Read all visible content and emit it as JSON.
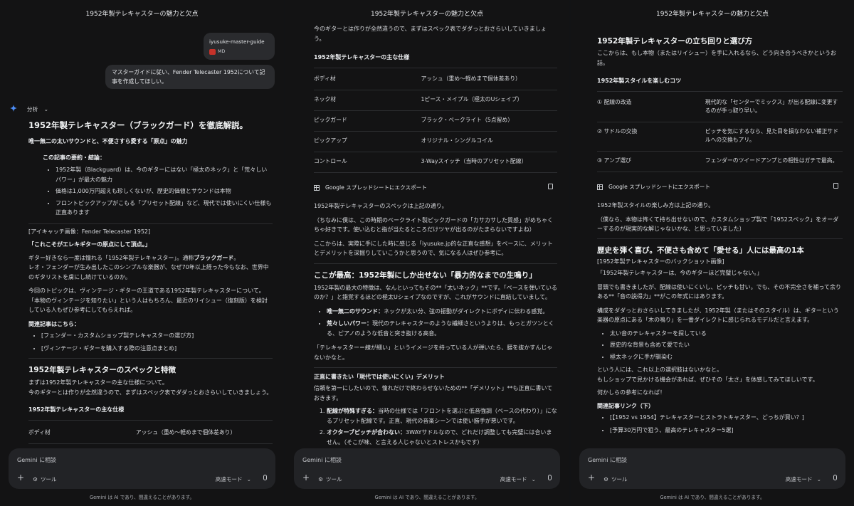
{
  "title": "1952年製テレキャスターの魅力と欠点",
  "colors": {
    "bg": "#131314",
    "bubble": "#2a2b2e",
    "input": "#222326",
    "accent_star": "#4c8df6"
  },
  "user": {
    "gem_name": "iyusuke-master-guide",
    "gem_tag": "MD",
    "message": "マスターガイドに従い、Fender Telecaster 1952について記事を作成してほしい。"
  },
  "analysis_label": "分析",
  "panel1": {
    "h1": "1952年製テレキャスター（ブラックガード）を徹底解説。",
    "subtitle": "唯一無二の太いサウンドと、不便さすら愛する「原点」の魅力",
    "summary_title": "この記事の要約・結論：",
    "summary_items": [
      "1952年製（Blackguard）は、今のギターにはない「極太のネック」と「荒々しいパワー」が最大の魅力",
      "価格は1,000万円超えも珍しくないが、歴史的価値とサウンドは本物",
      "フロントピックアップがこもる「プリセット配線」など、現代では使いにくい仕様も正直あります"
    ],
    "eyecatch": "[アイキャッチ画像：Fender Telecaster 1952]",
    "catch": "「これこそがエレキギターの原点にして頂点。」",
    "intro1a": "ギター好きなら一度は憧れる「1952年製テレキャスター」。通称",
    "intro1b": "ブラックガード",
    "intro1c": "。",
    "intro2": "レオ・フェンダーが生み出したこのシンプルな楽器が、なぜ70年以上経った今もなお、世界中のギタリストを虜にし続けているのか。",
    "intro3": "今回のトピックは、ヴィンテージ・ギターの王道である1952年製テレキャスターについて。「本物のヴィンテージを知りたい」という人はもちろん、最近のリイシュー（復刻版）を検討している人もぜひ参考にしてもらえれば。",
    "related_title": "関連記事はこちら：",
    "related": [
      "[フェンダー・カスタムショップ製テレキャスターの選び方]",
      "[ヴィンテージ・ギターを購入する際の注意点まとめ]"
    ],
    "spec_h": "1952年製テレキャスターのスペックと特徴",
    "spec_p1": "まずは1952年製テレキャスターの主な仕様について。",
    "spec_p2": "今のギターとは作りが全然違うので、まずはスペック表でダダっとおさらいしていきましょう。",
    "table_title": "1952年製テレキャスターの主な仕様",
    "partial_row": [
      "ボディ材",
      "アッシュ（重め〜軽めまで個体差あり）"
    ]
  },
  "panel2": {
    "top": "今のギターとは作りが全然違うので、まずはスペック表でダダっとおさらいしていきましょう。",
    "table_title": "1952年製テレキャスターの主な仕様",
    "rows": [
      [
        "ボディ材",
        "アッシュ（重め〜軽めまで個体差あり）"
      ],
      [
        "ネック材",
        "1ピース・メイプル（極太のUシェイプ）"
      ],
      [
        "ピックガード",
        "ブラック・ベークライト（5点留め）"
      ],
      [
        "ピックアップ",
        "オリジナル・シングルコイル"
      ],
      [
        "コントロール",
        "3-Wayスイッチ（当時のプリセット配線）"
      ]
    ],
    "export": "Google スプレッドシートにエクスポート",
    "after": "1952年製テレキャスターのスペックは上記の通り。",
    "aside": "（ちなみに僕は、この時期のベークライト製ピックガードの「カサカサした質感」がめちゃくちゃ好きです。使い込むと指が当たるところだけツヤが出るのがたまらないですよね）",
    "lead": "ここからは、実際に手にした時に感じる「iyusuke.jp的な正直な感想」をベースに、メリットとデメリットを深掘りしていこうかと思うので、気になる人はぜひ参考に。",
    "h_best": "ここが最高：1952年製にしか出せない「暴力的なまでの生鳴り」",
    "best_p": "1952年製の最大の特徴は、なんといってもその**「太いネック」**です。「ベースを弾いているのか？」と錯覚するほどの極太Uシェイプなのですが、これがサウンドに直結していまして。",
    "best_items": [
      {
        "b": "唯一無二のサウンド：",
        "t": "ネックが太い分、弦の振動がダイレクトにボディに伝わる感覚。"
      },
      {
        "b": "荒々しいパワー：",
        "t": "現代のテレキャスターのような繊細さというよりは、もっとガツンとくる、ピアノのような低音と突き抜ける高音。"
      }
    ],
    "image_p": "「テレキャスター＝線が細い」というイメージを持っている人が弾いたら、腰を抜かすんじゃないかなと。",
    "h_bad": "正直に書きたい「現代では使いにくい」デメリット",
    "bad_p": "信頼を第一にしたいので、憧れだけで終わらせないための**「デメリット」**も正直に書いておきます。",
    "bad_items": [
      {
        "b": "配線が特殊すぎる：",
        "t": "当時の仕様では「フロントを選ぶと低音強調（ベースの代わり）」になるプリセット配線です。正直、現代の音楽シーンでは使い勝手が悪いです。"
      },
      {
        "b": "オクターブピッチが合わない：",
        "t": "3WAYサドルなので、どれだけ調整しても完璧には合いません。（そこが味、と言える人じゃないとストレスかもです）"
      }
    ]
  },
  "panel3": {
    "h_choose": "1952年製テレキャスターの立ち回りと選び方",
    "choose_p": "ここからは、もし本物（またはリイシュー）を手に入れるなら、どう向き合うべきかというお話。",
    "tips_title": "1952年製スタイルを楽しむコツ",
    "tips": [
      [
        "① 配線の改造",
        "現代的な「センターでミックス」が出る配線に変更するのが手っ取り早い。"
      ],
      [
        "② サドルの交換",
        "ピッチを気にするなら、見た目を損なわない補正サドルへの交換もアリ。"
      ],
      [
        "③ アンプ選び",
        "フェンダーのツイードアンプとの相性はガチで最高。"
      ]
    ],
    "export": "Google スプレッドシートにエクスポート",
    "after": "1952年製スタイルの楽しみ方は上記の通り。",
    "aside": "（僕なら、本物は怖くて持ち出せないので、カスタムショップ製で「1952スペック」をオーダーするのが現実的な解じゃないかな、と思っていました）",
    "h_final": "歴史を弾く喜び。不便さも含めて「愛せる」人には最高の1本",
    "backshot": "[1952年製テレキャスターのバックショット画像]",
    "quote": "「1952年製テレキャスターは、今のギターほど完璧じゃない。」",
    "p1": "冒頭でも書きましたが、配線は使いにくいし、ピッチも甘い。でも、その不完全さを補って余りある**「音の説得力」**がこの年式にはあります。",
    "p2": "構成をダダっとおさらいしてきましたが、1952年製（またはそのスタイル）は、ギターという楽器の原点にある「木の鳴り」を一番ダイレクトに感じられるモデルだと言えます。",
    "list": [
      "太い音のテレキャスターを探している",
      "歴史的な背景も含めて愛でたい",
      "極太ネックに手が馴染む"
    ],
    "p3": "という人には、これ以上の選択肢はないかなと。",
    "p4": "もしショップで見かける機会があれば、ぜひその「太さ」を体感してみてほしいです。",
    "p5": "何かしらの参考になれば！",
    "links_title": "関連記事リンク（下）",
    "links": [
      "[【1952 vs 1954】テレキャスターとストラトキャスター、どっちが買い？]",
      "[予算30万円で狙う、最高のテレキャスター5選]"
    ]
  },
  "input": {
    "placeholder": "Gemini に相談",
    "tools": "ツール",
    "mode": "高速モード"
  },
  "disclaimer": "Gemini は AI であり、間違えることがあります。"
}
